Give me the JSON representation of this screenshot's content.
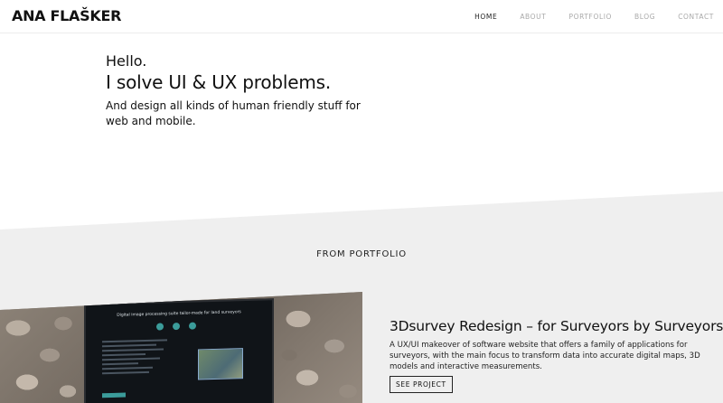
{
  "header": {
    "logo": "ANA FLAŠKER",
    "nav": [
      {
        "label": "HOME",
        "active": true
      },
      {
        "label": "ABOUT",
        "active": false
      },
      {
        "label": "PORTFOLIO",
        "active": false
      },
      {
        "label": "BLOG",
        "active": false
      },
      {
        "label": "CONTACT",
        "active": false
      }
    ]
  },
  "hero": {
    "greeting": "Hello.",
    "headline": "I solve UI & UX problems.",
    "subline": "And design all kinds of human friendly stuff for web and mobile."
  },
  "portfolio": {
    "section_title": "FROM PORTFOLIO",
    "project": {
      "image_screen_title": "Digital image processing suite tailor-made for land surveyors",
      "title": "3Dsurvey Redesign – for Surveyors by Surveyors",
      "description": "A UX/UI makeover of software website that offers a family of applications for surveyors, with the main focus to transform data into accurate digital maps, 3D models and interactive measurements.",
      "cta": "SEE PROJECT"
    }
  },
  "colors": {
    "text": "#111111",
    "nav_inactive": "#a9a9a9",
    "section_bg": "#efefef",
    "accent_teal": "#3b9c9a"
  }
}
